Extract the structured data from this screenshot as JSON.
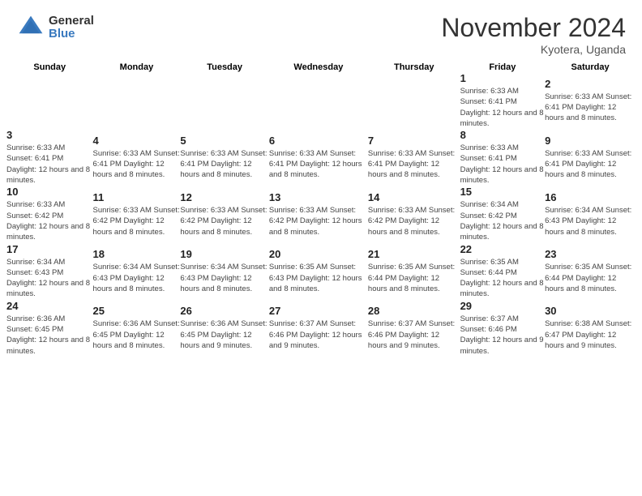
{
  "header": {
    "logo_general": "General",
    "logo_blue": "Blue",
    "month_title": "November 2024",
    "location": "Kyotera, Uganda"
  },
  "calendar": {
    "days_of_week": [
      "Sunday",
      "Monday",
      "Tuesday",
      "Wednesday",
      "Thursday",
      "Friday",
      "Saturday"
    ],
    "weeks": [
      [
        {
          "day": "",
          "info": ""
        },
        {
          "day": "",
          "info": ""
        },
        {
          "day": "",
          "info": ""
        },
        {
          "day": "",
          "info": ""
        },
        {
          "day": "",
          "info": ""
        },
        {
          "day": "1",
          "info": "Sunrise: 6:33 AM\nSunset: 6:41 PM\nDaylight: 12 hours and 8 minutes."
        },
        {
          "day": "2",
          "info": "Sunrise: 6:33 AM\nSunset: 6:41 PM\nDaylight: 12 hours and 8 minutes."
        }
      ],
      [
        {
          "day": "3",
          "info": "Sunrise: 6:33 AM\nSunset: 6:41 PM\nDaylight: 12 hours and 8 minutes."
        },
        {
          "day": "4",
          "info": "Sunrise: 6:33 AM\nSunset: 6:41 PM\nDaylight: 12 hours and 8 minutes."
        },
        {
          "day": "5",
          "info": "Sunrise: 6:33 AM\nSunset: 6:41 PM\nDaylight: 12 hours and 8 minutes."
        },
        {
          "day": "6",
          "info": "Sunrise: 6:33 AM\nSunset: 6:41 PM\nDaylight: 12 hours and 8 minutes."
        },
        {
          "day": "7",
          "info": "Sunrise: 6:33 AM\nSunset: 6:41 PM\nDaylight: 12 hours and 8 minutes."
        },
        {
          "day": "8",
          "info": "Sunrise: 6:33 AM\nSunset: 6:41 PM\nDaylight: 12 hours and 8 minutes."
        },
        {
          "day": "9",
          "info": "Sunrise: 6:33 AM\nSunset: 6:41 PM\nDaylight: 12 hours and 8 minutes."
        }
      ],
      [
        {
          "day": "10",
          "info": "Sunrise: 6:33 AM\nSunset: 6:42 PM\nDaylight: 12 hours and 8 minutes."
        },
        {
          "day": "11",
          "info": "Sunrise: 6:33 AM\nSunset: 6:42 PM\nDaylight: 12 hours and 8 minutes."
        },
        {
          "day": "12",
          "info": "Sunrise: 6:33 AM\nSunset: 6:42 PM\nDaylight: 12 hours and 8 minutes."
        },
        {
          "day": "13",
          "info": "Sunrise: 6:33 AM\nSunset: 6:42 PM\nDaylight: 12 hours and 8 minutes."
        },
        {
          "day": "14",
          "info": "Sunrise: 6:33 AM\nSunset: 6:42 PM\nDaylight: 12 hours and 8 minutes."
        },
        {
          "day": "15",
          "info": "Sunrise: 6:34 AM\nSunset: 6:42 PM\nDaylight: 12 hours and 8 minutes."
        },
        {
          "day": "16",
          "info": "Sunrise: 6:34 AM\nSunset: 6:43 PM\nDaylight: 12 hours and 8 minutes."
        }
      ],
      [
        {
          "day": "17",
          "info": "Sunrise: 6:34 AM\nSunset: 6:43 PM\nDaylight: 12 hours and 8 minutes."
        },
        {
          "day": "18",
          "info": "Sunrise: 6:34 AM\nSunset: 6:43 PM\nDaylight: 12 hours and 8 minutes."
        },
        {
          "day": "19",
          "info": "Sunrise: 6:34 AM\nSunset: 6:43 PM\nDaylight: 12 hours and 8 minutes."
        },
        {
          "day": "20",
          "info": "Sunrise: 6:35 AM\nSunset: 6:43 PM\nDaylight: 12 hours and 8 minutes."
        },
        {
          "day": "21",
          "info": "Sunrise: 6:35 AM\nSunset: 6:44 PM\nDaylight: 12 hours and 8 minutes."
        },
        {
          "day": "22",
          "info": "Sunrise: 6:35 AM\nSunset: 6:44 PM\nDaylight: 12 hours and 8 minutes."
        },
        {
          "day": "23",
          "info": "Sunrise: 6:35 AM\nSunset: 6:44 PM\nDaylight: 12 hours and 8 minutes."
        }
      ],
      [
        {
          "day": "24",
          "info": "Sunrise: 6:36 AM\nSunset: 6:45 PM\nDaylight: 12 hours and 8 minutes."
        },
        {
          "day": "25",
          "info": "Sunrise: 6:36 AM\nSunset: 6:45 PM\nDaylight: 12 hours and 8 minutes."
        },
        {
          "day": "26",
          "info": "Sunrise: 6:36 AM\nSunset: 6:45 PM\nDaylight: 12 hours and 9 minutes."
        },
        {
          "day": "27",
          "info": "Sunrise: 6:37 AM\nSunset: 6:46 PM\nDaylight: 12 hours and 9 minutes."
        },
        {
          "day": "28",
          "info": "Sunrise: 6:37 AM\nSunset: 6:46 PM\nDaylight: 12 hours and 9 minutes."
        },
        {
          "day": "29",
          "info": "Sunrise: 6:37 AM\nSunset: 6:46 PM\nDaylight: 12 hours and 9 minutes."
        },
        {
          "day": "30",
          "info": "Sunrise: 6:38 AM\nSunset: 6:47 PM\nDaylight: 12 hours and 9 minutes."
        }
      ]
    ]
  }
}
